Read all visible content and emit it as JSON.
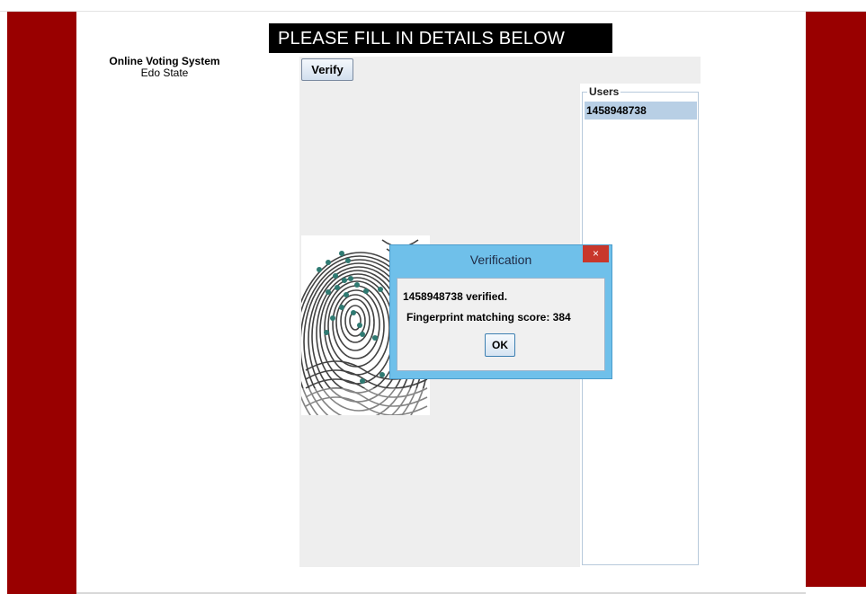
{
  "app": {
    "name": "Online Voting System",
    "state": "Edo State"
  },
  "banner": {
    "text": "PLEASE FILL IN DETAILS BELOW"
  },
  "toolbar": {
    "verify_label": "Verify"
  },
  "users": {
    "legend": "Users",
    "items": [
      {
        "label": "1458948738",
        "selected": true
      }
    ]
  },
  "dialog": {
    "title": "Verification",
    "close_glyph": "×",
    "message_verified": "1458948738 verified.",
    "message_score": "Fingerprint matching score: 384",
    "ok_label": "OK"
  },
  "colors": {
    "side_bars": "#990000",
    "banner_bg": "#000000",
    "dialog_frame": "#6fc0ea",
    "close_button": "#c8372b",
    "selected_row": "#b8cfe5",
    "minutiae_dots": "#2f7a72"
  }
}
